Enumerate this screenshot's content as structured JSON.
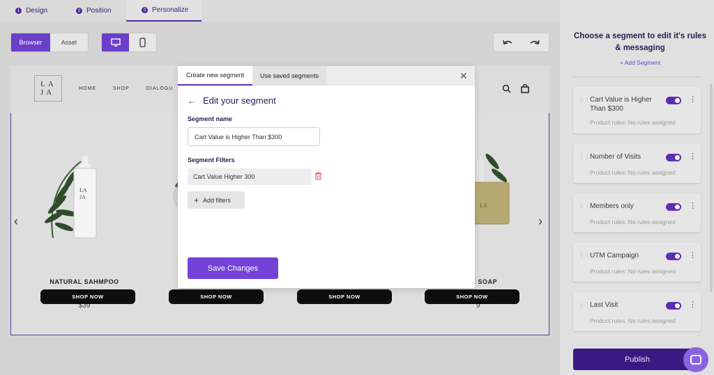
{
  "steps": [
    {
      "num": "1",
      "label": "Design"
    },
    {
      "num": "2",
      "label": "Position"
    },
    {
      "num": "3",
      "label": "Personalize"
    }
  ],
  "toolbar": {
    "browser_label": "Browser",
    "asset_label": "Asset",
    "desktop_icon": "monitor-icon",
    "mobile_icon": "phone-icon",
    "undo_icon": "undo-icon",
    "redo_icon": "redo-icon"
  },
  "preview": {
    "logo": "LA JA",
    "nav": [
      "HOME",
      "SHOP",
      "DIALOGU"
    ],
    "products": [
      {
        "name": "NATURAL SAHMPOO",
        "price": "$39",
        "button": "SHOP NOW"
      },
      {
        "name": "",
        "price": "",
        "button": "SHOP NOW"
      },
      {
        "name": "",
        "price": "",
        "button": "SHOP NOW"
      },
      {
        "name": "E SOAP",
        "price": "9",
        "button": "SHOP NOW"
      }
    ]
  },
  "modal": {
    "tabs": [
      "Create new segment",
      "Use saved segments"
    ],
    "title": "Edit your segment",
    "segment_name_label": "Segment name",
    "segment_name_value": "Cart Value is Higher Than $300",
    "filters_label": "Segment Filters",
    "filters": [
      "Cart Value Higher 300"
    ],
    "add_filters_label": "Add filters",
    "save_label": "Save Changes"
  },
  "panel": {
    "title": "Choose a segment to edit it's rules & messaging",
    "add_segment": "+ Add Segment",
    "segments": [
      {
        "name": "Cart Value is Higher Than $300",
        "rules": "Product rules: No rules assigned",
        "enabled": true
      },
      {
        "name": "Number of Visits",
        "rules": "Product rules: No rules assigned",
        "enabled": true
      },
      {
        "name": "Members only",
        "rules": "Product rules: No rules assigned",
        "enabled": true
      },
      {
        "name": "UTM Campaign",
        "rules": "Product rules: No rules assigned",
        "enabled": true
      },
      {
        "name": "Last Visit",
        "rules": "Product rules: No rules assigned",
        "enabled": true
      }
    ],
    "publish_label": "Publish"
  },
  "colors": {
    "accent": "#6b3fc9",
    "publish": "#3a1a82",
    "dark_text": "#2a1b52"
  }
}
